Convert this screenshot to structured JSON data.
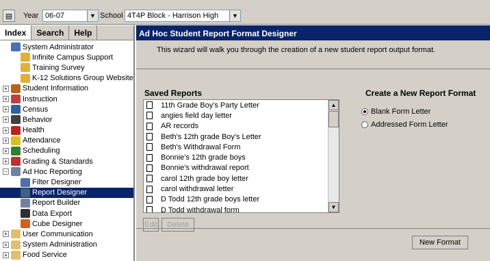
{
  "topbar": {
    "year_label": "Year",
    "year_value": "06-07",
    "school_label": "School",
    "school_value": "4T4P Block - Harrison High"
  },
  "nav_tabs": [
    "Index",
    "Search",
    "Help"
  ],
  "tree": [
    {
      "label": "System Administrator",
      "level": 0,
      "expander": "",
      "icon": "#4a6fb5"
    },
    {
      "label": "Infinite Campus Support",
      "level": 1,
      "expander": "",
      "icon": "#e0b03a"
    },
    {
      "label": "Training Survey",
      "level": 1,
      "expander": "",
      "icon": "#e0b03a"
    },
    {
      "label": "K-12 Solutions Group Website",
      "level": 1,
      "expander": "",
      "icon": "#e0b03a"
    },
    {
      "label": "Student Information",
      "level": 0,
      "expander": "+",
      "icon": "#b5651d"
    },
    {
      "label": "Instruction",
      "level": 0,
      "expander": "+",
      "icon": "#c04040"
    },
    {
      "label": "Census",
      "level": 0,
      "expander": "+",
      "icon": "#3060a0"
    },
    {
      "label": "Behavior",
      "level": 0,
      "expander": "+",
      "icon": "#404040"
    },
    {
      "label": "Health",
      "level": 0,
      "expander": "+",
      "icon": "#c02020"
    },
    {
      "label": "Attendance",
      "level": 0,
      "expander": "+",
      "icon": "#d8c020"
    },
    {
      "label": "Scheduling",
      "level": 0,
      "expander": "+",
      "icon": "#308030"
    },
    {
      "label": "Grading & Standards",
      "level": 0,
      "expander": "+",
      "icon": "#c03030"
    },
    {
      "label": "Ad Hoc Reporting",
      "level": 0,
      "expander": "−",
      "icon": "#7080a0"
    },
    {
      "label": "Filter Designer",
      "level": 1,
      "expander": "",
      "icon": "#5070b0"
    },
    {
      "label": "Report Designer",
      "level": 1,
      "expander": "",
      "icon": "#406080",
      "selected": true
    },
    {
      "label": "Report Builder",
      "level": 1,
      "expander": "",
      "icon": "#7080a0"
    },
    {
      "label": "Data Export",
      "level": 1,
      "expander": "",
      "icon": "#303030"
    },
    {
      "label": "Cube Designer",
      "level": 1,
      "expander": "",
      "icon": "#d06020"
    },
    {
      "label": "User Communication",
      "level": 0,
      "expander": "+",
      "icon": "#e0c070"
    },
    {
      "label": "System Administration",
      "level": 0,
      "expander": "+",
      "icon": "#e0c070"
    },
    {
      "label": "Food Service",
      "level": 0,
      "expander": "+",
      "icon": "#e0c070"
    }
  ],
  "main": {
    "title": "Ad Hoc Student Report Format Designer",
    "intro": "This wizard will walk you through the creation of a new student report output format.",
    "saved_reports_heading": "Saved Reports",
    "create_heading": "Create a New Report Format",
    "saved_reports": [
      "11th Grade Boy's Party Letter",
      "angies field day letter",
      "AR records",
      "Beth's 12th grade Boy's Letter",
      "Beth's Withdrawal Form",
      "Bonnie's 12th grade boys",
      "Bonnie's withdrawal report",
      "carol 12th grade boy letter",
      "carol withdrawal letter",
      "D Todd 12th grade boys letter",
      "D Todd withdrawal form"
    ],
    "options": [
      {
        "label": "Blank Form Letter",
        "checked": true
      },
      {
        "label": "Addressed Form Letter",
        "checked": false
      }
    ],
    "edit_label": "Edit",
    "delete_label": "Delete",
    "new_format_label": "New Format"
  }
}
